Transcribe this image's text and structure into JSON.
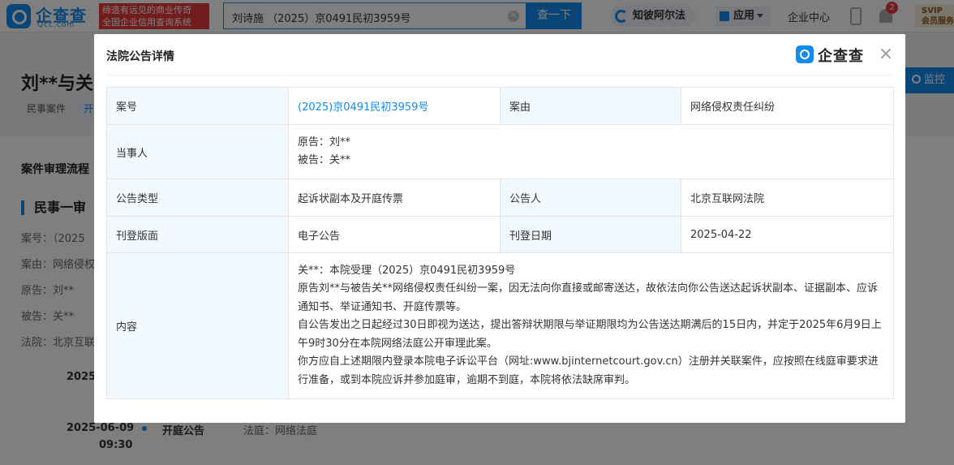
{
  "header": {
    "logo_text": "企查查",
    "logo_sub": "Qcc.com",
    "slogan_line1": "缔造有远见的商业传奇",
    "slogan_line2": "全国企业信用查询系统",
    "search_value": "刘诗施 （2025）京0491民初3959号",
    "search_button": "查一下",
    "zhibi_label": "知彼阿尔法",
    "app_label": "应用",
    "center_label": "企业中心",
    "notification_count": "2",
    "vip_line1": "SVIP",
    "vip_line2": "会员服务"
  },
  "background": {
    "page_title": "刘**与关",
    "tag1": "民事案件",
    "tag2": "开",
    "monitor_button": "监控",
    "section_title": "案件审理流程",
    "sub_title": "民事一审",
    "info": [
      "案号：（2025",
      "案由：网络侵权",
      "原告：刘**",
      "被告：关**",
      "法院：北京互联"
    ],
    "timeline": {
      "date1": "2025",
      "date2": "2025-06-09",
      "time2": "09:30",
      "event2": "开庭公告",
      "court2": "法庭：网络法庭"
    }
  },
  "modal": {
    "title": "法院公告详情",
    "logo_text": "企查查",
    "close_symbol": "×",
    "rows": {
      "case_no_label": "案号",
      "case_no_value": "(2025)京0491民初3959号",
      "cause_label": "案由",
      "cause_value": "网络侵权责任纠纷",
      "party_label": "当事人",
      "plaintiff": "原告：刘**",
      "defendant": "被告：关**",
      "notice_type_label": "公告类型",
      "notice_type_value": "起诉状副本及开庭传票",
      "announcer_label": "公告人",
      "announcer_value": "北京互联网法院",
      "page_label": "刊登版面",
      "page_value": "电子公告",
      "date_label": "刊登日期",
      "date_value": "2025-04-22",
      "content_label": "内容",
      "content_lines": [
        "关**：本院受理（2025）京0491民初3959号",
        "原告刘**与被告关**网络侵权责任纠纷一案，因无法向你直接或邮寄送达，故依法向你公告送达起诉状副本、证据副本、应诉通知书、举证通知书、开庭传票等。",
        "自公告发出之日起经过30日即视为送达，提出答辩状期限与举证期限均为公告送达期满后的15日内，并定于2025年6月9日上午9时30分在本院网络法庭公开审理此案。",
        "你方应自上述期限内登录本院电子诉讼平台（网址:www.bjinternetcourt.gov.cn）注册并关联案件，应按照在线庭审要求进行准备，或到本院应诉并参加庭审，逾期不到庭，本院将依法缺席审判。"
      ]
    }
  }
}
